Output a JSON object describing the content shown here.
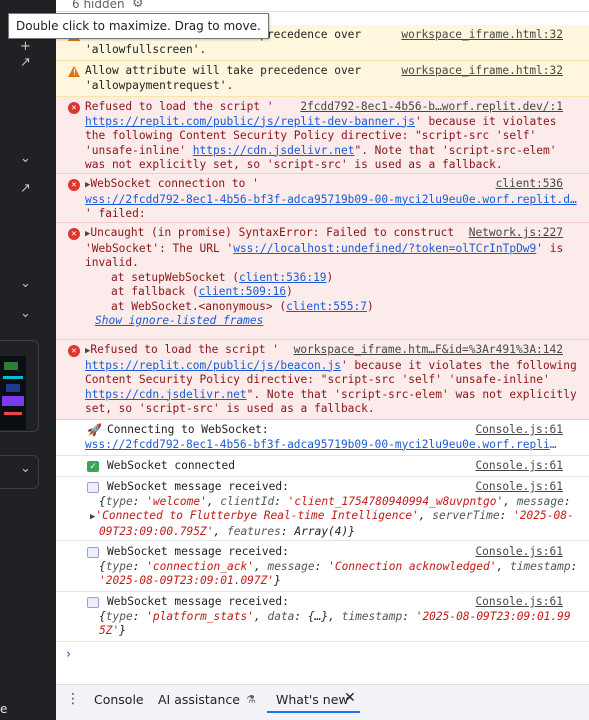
{
  "tooltip": "Double click to maximize. Drag to move.",
  "topbar": {
    "hidden_count": "6 hidden"
  },
  "left_bar": {
    "bottom_text": "e"
  },
  "messages": {
    "w1": {
      "text_a": "Allow attribute will take precedence over",
      "text_b": "'allowfullscreen'.",
      "source": "workspace_iframe.html:32"
    },
    "w2": {
      "text_a": "Allow attribute will take precedence over",
      "text_b": "'allowpaymentrequest'.",
      "source": "workspace_iframe.html:32"
    },
    "e1": {
      "line1": "Refused to load the script '",
      "source": "2fcdd792-8ec1-4b56-b…worf.replit.dev/:1",
      "url": "https://replit.com/public/js/replit-dev-banner.js",
      "line2_tail": "' because it violates",
      "line3": "the following Content Security Policy directive: \"script-src 'self'",
      "line4_a": "'unsafe-inline'",
      "line4_link": "https://cdn.jsdelivr.net",
      "line4_b": "\". Note that 'script-src-elem'",
      "line5": "was not explicitly set, so 'script-src' is used as a fallback."
    },
    "e2": {
      "line1": "WebSocket connection to '",
      "source": "client:536",
      "url": "wss://2fcdd792-8ec1-4b56-bf3f-adca95719b09-00-myci2lu9eu0e.worf.replit.d…",
      "line3": "' failed:"
    },
    "e3": {
      "line1": "Uncaught (in promise) SyntaxError: Failed to construct",
      "source": "Network.js:227",
      "line2_a": "'WebSocket': The URL '",
      "line2_link": "wss://localhost:undefined/?token=olTCrInTpDw9",
      "line2_b": "' is",
      "line3": "invalid.",
      "st1_a": "at setupWebSocket (",
      "st1_link": "client:536:19",
      "st2_a": "at fallback (",
      "st2_link": "client:509:16",
      "st3_a": "at WebSocket.<anonymous> (",
      "st3_link": "client:555:7",
      "close": ")",
      "ignore": "Show ignore-listed frames"
    },
    "e4": {
      "line1": "Refused to load the script '",
      "source": "workspace_iframe.htm…F&id=%3Ar491%3A:142",
      "url": "https://replit.com/public/js/beacon.js",
      "line2_tail": "' because it violates the following",
      "line3": "Content Security Policy directive: \"script-src 'self' 'unsafe-inline'",
      "line4_link": "https://cdn.jsdelivr.net",
      "line4_b": "\". Note that 'script-src-elem' was not explicitly",
      "line5": "set, so 'script-src' is used as a fallback."
    },
    "l1": {
      "text": "Connecting to WebSocket:",
      "source": "Console.js:61",
      "url": "wss://2fcdd792-8ec1-4b56-bf3f-adca95719b09-00-myci2lu9eu0e.worf.replit.dev/ws"
    },
    "l2": {
      "text": "WebSocket connected",
      "source": "Console.js:61"
    },
    "l3": {
      "text": "WebSocket message received:",
      "source": "Console.js:61",
      "k1": "type",
      "v1": "'welcome'",
      "k2": "clientId",
      "v2": "'client_1754780940994_w8uvpntgo'",
      "k3": "message",
      "v3": "'Connected to Flutterbye Real-time Intelligence'",
      "k4": "serverTime",
      "v4": "'2025-08-",
      "v4b": "09T23:09:00.795Z'",
      "k5": "features",
      "v5": "Array(4)"
    },
    "l4": {
      "text": "WebSocket message received:",
      "source": "Console.js:61",
      "k1": "type",
      "v1": "'connection_ack'",
      "k2": "message",
      "v2": "'Connection acknowledged'",
      "k3": "timestamp",
      "v3": "'2025-08-09T23:09:01.097Z'"
    },
    "l5": {
      "text": "WebSocket message received:",
      "source": "Console.js:61",
      "k1": "type",
      "v1": "'platform_stats'",
      "k2": "data",
      "v2": "{…}",
      "k3": "timestamp",
      "v3": "'2025-08-09T23:09:01.99",
      "v3b": "5Z'"
    }
  },
  "drawer": {
    "tab_console": "Console",
    "tab_ai": "AI assistance",
    "tab_whatsnew": "What's new"
  }
}
